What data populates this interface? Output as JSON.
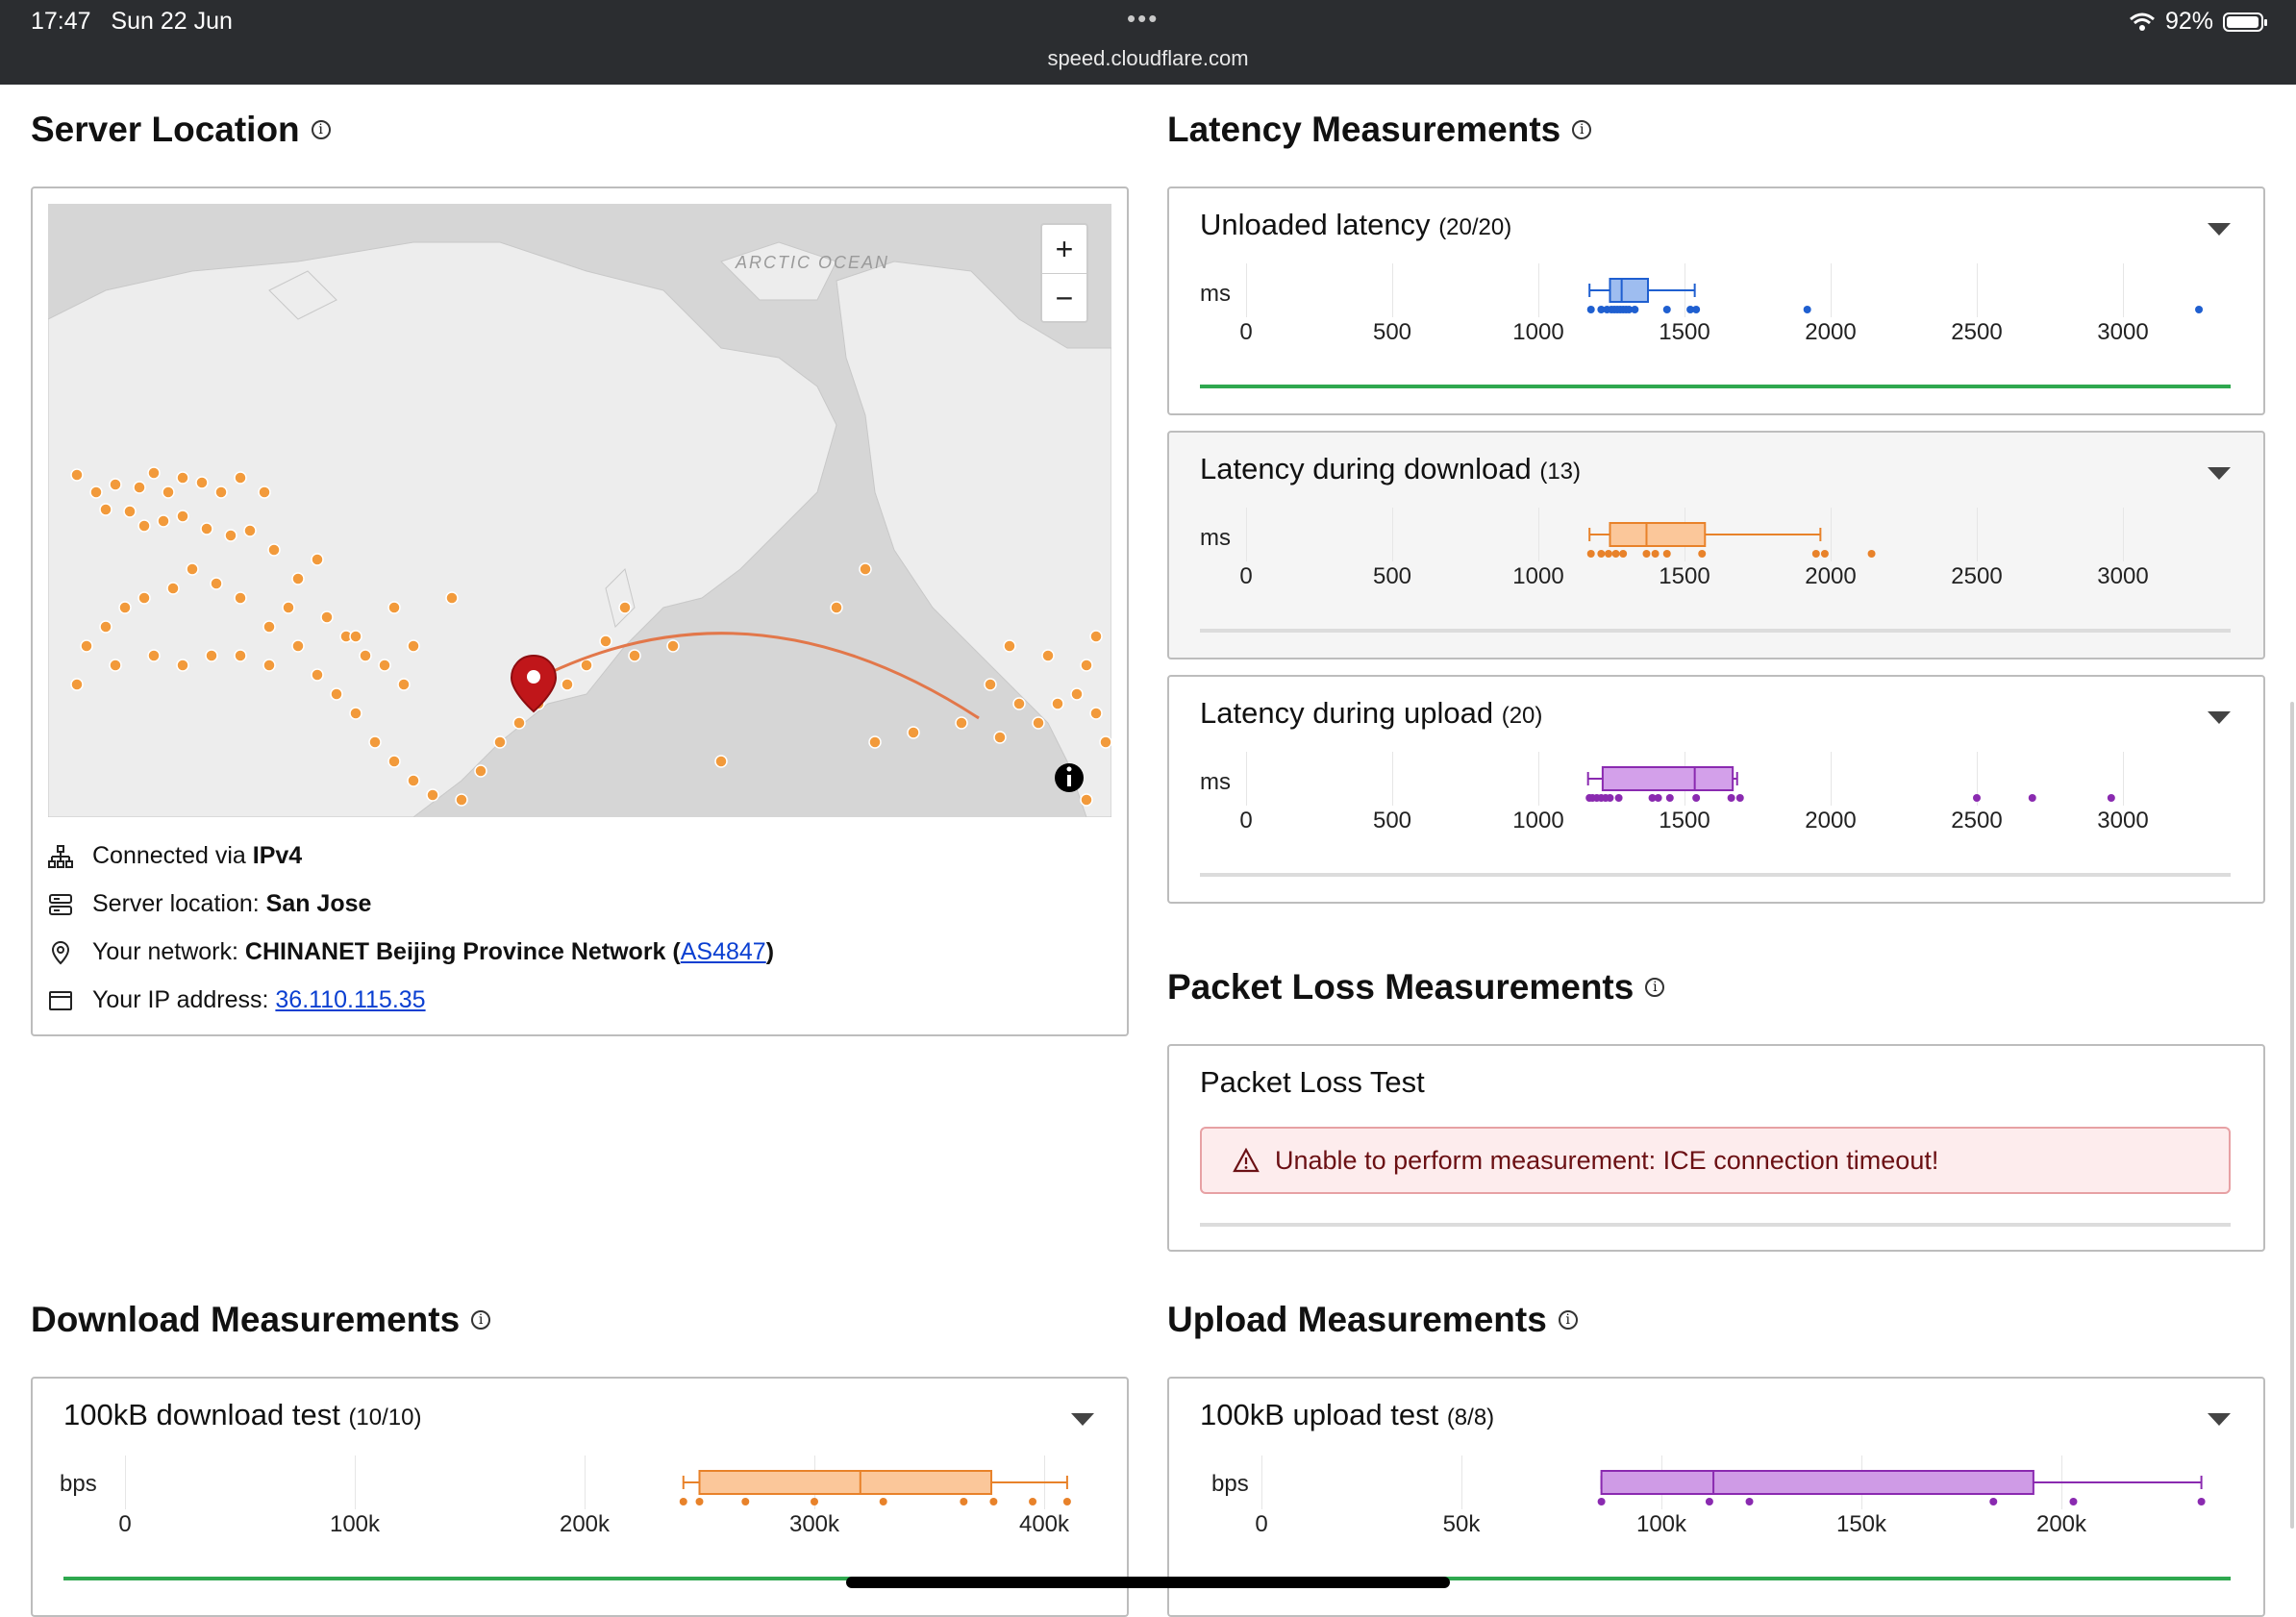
{
  "statusbar": {
    "time": "17:47",
    "date": "Sun 22 Jun",
    "battery": "92%",
    "url": "speed.cloudflare.com",
    "dots": "•••"
  },
  "server": {
    "title": "Server Location",
    "map_label": "ARCTIC OCEAN",
    "zoom_in": "+",
    "zoom_out": "−",
    "connected_prefix": "Connected via ",
    "connected_value": "IPv4",
    "location_prefix": "Server location: ",
    "location_value": "San Jose",
    "network_prefix": "Your network: ",
    "network_value": "CHINANET Beijing Province Network",
    "network_open": "(",
    "network_as": "AS4847",
    "network_close": ")",
    "ip_prefix": "Your IP address: ",
    "ip_value": "36.110.115.35"
  },
  "latency": {
    "title": "Latency Measurements",
    "unit": "ms",
    "ticks": [
      "0",
      "500",
      "1000",
      "1500",
      "2000",
      "2500",
      "3000"
    ],
    "cards": [
      {
        "label": "Unloaded latency",
        "count": "(20/20)",
        "color": "#1f5fd0",
        "fill": "#9ebdf0",
        "q1": 1245,
        "median": 1285,
        "q3": 1375,
        "wmin": 1175,
        "wmax": 1535,
        "points": [
          1180,
          1215,
          1235,
          1250,
          1260,
          1270,
          1280,
          1290,
          1300,
          1310,
          1330,
          1440,
          1520,
          1540,
          1920,
          3260
        ]
      },
      {
        "label": "Latency during download",
        "count": "(13)",
        "color": "#e8822a",
        "fill": "#fbc79a",
        "q1": 1245,
        "median": 1370,
        "q3": 1570,
        "wmin": 1175,
        "wmax": 1965,
        "points": [
          1180,
          1215,
          1240,
          1265,
          1290,
          1370,
          1400,
          1440,
          1560,
          1950,
          1980,
          2140
        ]
      },
      {
        "label": "Latency during upload",
        "count": "(20)",
        "color": "#8a2ab0",
        "fill": "#d3a0ea",
        "q1": 1220,
        "median": 1535,
        "q3": 1665,
        "wmin": 1170,
        "wmax": 1680,
        "points": [
          1175,
          1185,
          1200,
          1215,
          1230,
          1245,
          1275,
          1390,
          1410,
          1450,
          1540,
          1660,
          1690,
          2500,
          2690,
          2960
        ]
      }
    ]
  },
  "packet_loss": {
    "title": "Packet Loss Measurements",
    "card_title": "Packet Loss Test",
    "message": "Unable to perform measurement: ICE connection timeout!"
  },
  "download": {
    "title": "Download Measurements",
    "card_label": "100kB download test",
    "count": "(10/10)",
    "unit": "bps",
    "ticks": [
      "0",
      "100k",
      "200k",
      "300k",
      "400k"
    ],
    "color": "#e8822a",
    "fill": "#fbc79a",
    "q1": 250000,
    "median": 320000,
    "q3": 377000,
    "wmin": 243000,
    "wmax": 410000,
    "points": [
      243000,
      250000,
      270000,
      300000,
      330000,
      365000,
      378000,
      395000,
      410000
    ]
  },
  "upload": {
    "title": "Upload Measurements",
    "card_label": "100kB upload test",
    "count": "(8/8)",
    "unit": "bps",
    "ticks": [
      "0",
      "50k",
      "100k",
      "150k",
      "200k"
    ],
    "color": "#8a2ab0",
    "fill": "#cf9be6",
    "q1": 85000,
    "median": 113000,
    "q3": 193000,
    "wmin": 85000,
    "wmax": 235000,
    "points": [
      85000,
      112000,
      122000,
      183000,
      203000,
      235000
    ]
  }
}
